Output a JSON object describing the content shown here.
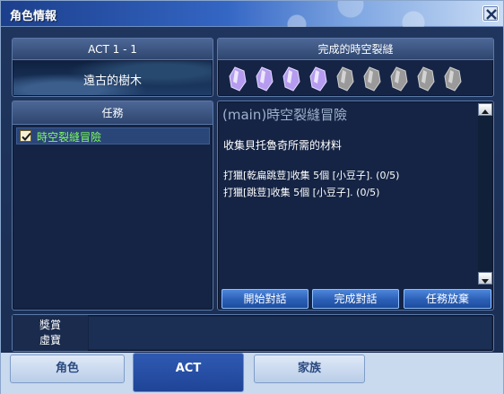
{
  "window": {
    "title": "角色情報"
  },
  "act": {
    "header": "ACT 1 - 1",
    "place": "遠古的樹木"
  },
  "rifts": {
    "header": "完成的時空裂縫",
    "slots": [
      {
        "state": "completed"
      },
      {
        "state": "completed"
      },
      {
        "state": "completed"
      },
      {
        "state": "completed"
      },
      {
        "state": "empty"
      },
      {
        "state": "empty"
      },
      {
        "state": "empty"
      },
      {
        "state": "empty"
      },
      {
        "state": "empty"
      }
    ],
    "completed_count": 4,
    "total": 9
  },
  "quests": {
    "header": "任務",
    "items": [
      {
        "label": "時空裂縫冒險",
        "checked": true
      }
    ]
  },
  "detail": {
    "title": "(main)時空裂縫冒險",
    "description": "收集貝托魯奇所需的材料",
    "objectives": [
      "打獵[乾扁跳荳]收集 5個 [小豆子]. (0/5)",
      "打獵[跳荳]收集 5個 [小豆子]. (0/5)"
    ]
  },
  "buttons": {
    "start": "開始對話",
    "complete": "完成對話",
    "abandon": "任務放棄"
  },
  "reward": {
    "label_line1": "獎賞",
    "label_line2": "虛寶"
  },
  "tabs": {
    "role": "角色",
    "act": "ACT",
    "family": "家族"
  },
  "colors": {
    "quest_label": "#7fff5a",
    "rift_completed": "#b59cf0",
    "rift_empty": "#9a9a9a",
    "active_tab": "#2f5ab2"
  }
}
